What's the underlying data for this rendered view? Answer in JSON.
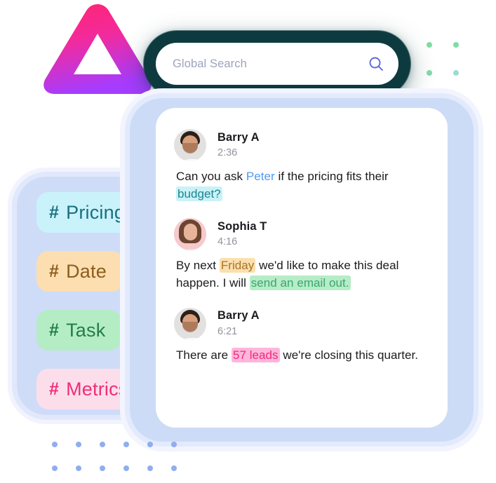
{
  "search": {
    "placeholder": "Global Search",
    "value": "",
    "icon": "search-icon"
  },
  "tags": {
    "items": [
      {
        "hash": "#",
        "label": "Pricing",
        "bg": "#c9f2fb",
        "fg": "#1b6f7e"
      },
      {
        "hash": "#",
        "label": "Date",
        "bg": "#fcdeb0",
        "fg": "#8c5e1c"
      },
      {
        "hash": "#",
        "label": "Task",
        "bg": "#b4edc4",
        "fg": "#237d4a"
      },
      {
        "hash": "#",
        "label": "Metrics",
        "bg": "#fcdeeb",
        "fg": "#ef2e77"
      }
    ]
  },
  "chat": {
    "messages": [
      {
        "author": "Barry A",
        "time": "2:36",
        "avatar": "avatar-barry",
        "parts": [
          {
            "text": "Can you ask ",
            "style": "plain"
          },
          {
            "text": "Peter",
            "style": "mention"
          },
          {
            "text": " if the pricing fits their ",
            "style": "plain"
          },
          {
            "text": "budget?",
            "style": "hl-cyan"
          }
        ]
      },
      {
        "author": "Sophia T",
        "time": "4:16",
        "avatar": "avatar-sophia",
        "parts": [
          {
            "text": "By next ",
            "style": "plain"
          },
          {
            "text": "Friday",
            "style": "hl-amber"
          },
          {
            "text": " we'd like to make this deal happen. I will ",
            "style": "plain"
          },
          {
            "text": "send an email out.",
            "style": "hl-green"
          }
        ]
      },
      {
        "author": "Barry A",
        "time": "6:21",
        "avatar": "avatar-barry",
        "parts": [
          {
            "text": "There are ",
            "style": "plain"
          },
          {
            "text": "57 leads",
            "style": "hl-pink"
          },
          {
            "text": " we're closing this quarter.",
            "style": "plain"
          }
        ]
      }
    ]
  },
  "decor": {
    "logo_gradient_from": "#ff2e87",
    "logo_gradient_to": "#a23bff",
    "search_bar_color": "#0d3a3f",
    "panel_color": "#cfdcf8",
    "dot_blue": "#8fadf0",
    "dot_green": "#7fdca7",
    "dot_teal": "#9adcd4",
    "dot_pink": "#e078ab",
    "topright_dots": [
      "#7fdca7",
      "#7fdca7",
      "#7fdca7",
      "#9adcd4"
    ],
    "bottomleft_dot_count": 12,
    "chip_rail_dots": [
      "#e078ab",
      "#c08cc9",
      "#9aa8e6",
      "#8fadf0",
      "#8fadf0"
    ]
  }
}
